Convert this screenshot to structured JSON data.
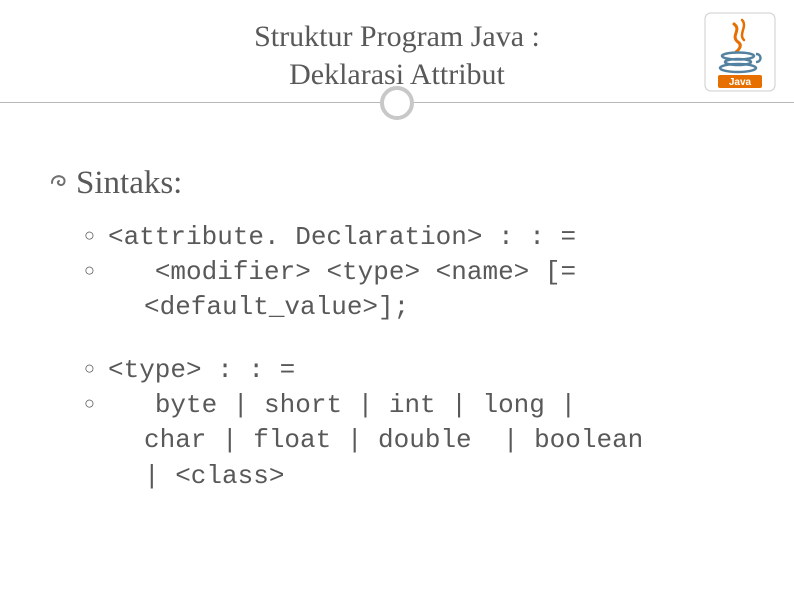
{
  "title": {
    "line1": "Struktur Program Java :",
    "line2": "Deklarasi Attribut"
  },
  "heading": "Sintaks:",
  "block1": {
    "line1": "<attribute. Declaration> : : =",
    "line2": "   <modifier> <type> <name> [=",
    "cont": "<default_value>];"
  },
  "block2": {
    "line1": "<type> : : =",
    "line2": "   byte | short | int | long |",
    "cont1": "char | float | double  | boolean",
    "cont2": "| <class>"
  },
  "logo_label": "Java"
}
